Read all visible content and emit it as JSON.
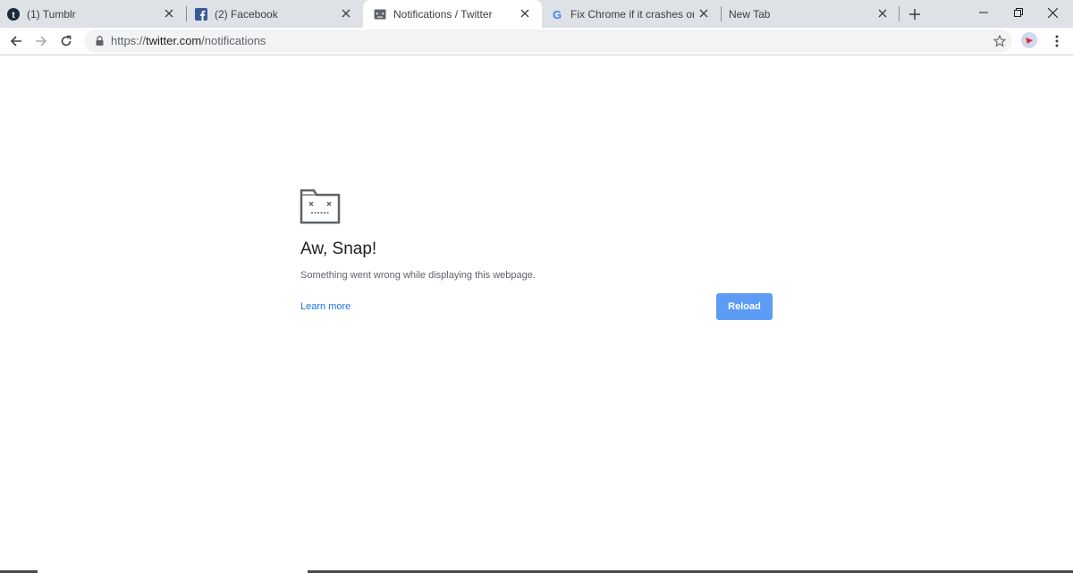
{
  "browser": {
    "tabs": [
      {
        "title": "(1) Tumblr",
        "favicon": "tumblr-icon"
      },
      {
        "title": "(2) Facebook",
        "favicon": "facebook-icon"
      },
      {
        "title": "Notifications / Twitter",
        "favicon": "twitter-icon",
        "active": true
      },
      {
        "title": "Fix Chrome if it crashes or won't open",
        "favicon": "google-icon"
      },
      {
        "title": "New Tab",
        "favicon": "none"
      }
    ],
    "address": {
      "scheme": "https://",
      "host": "twitter.com",
      "path": "/notifications"
    }
  },
  "error_page": {
    "icon": "sad-tab-icon",
    "title": "Aw, Snap!",
    "message": "Something went wrong while displaying this webpage.",
    "learn_more": "Learn more",
    "reload": "Reload"
  },
  "colors": {
    "tabstrip": "#dee1e6",
    "reload_button": "#5d9cf5",
    "link": "#1a73e8"
  }
}
